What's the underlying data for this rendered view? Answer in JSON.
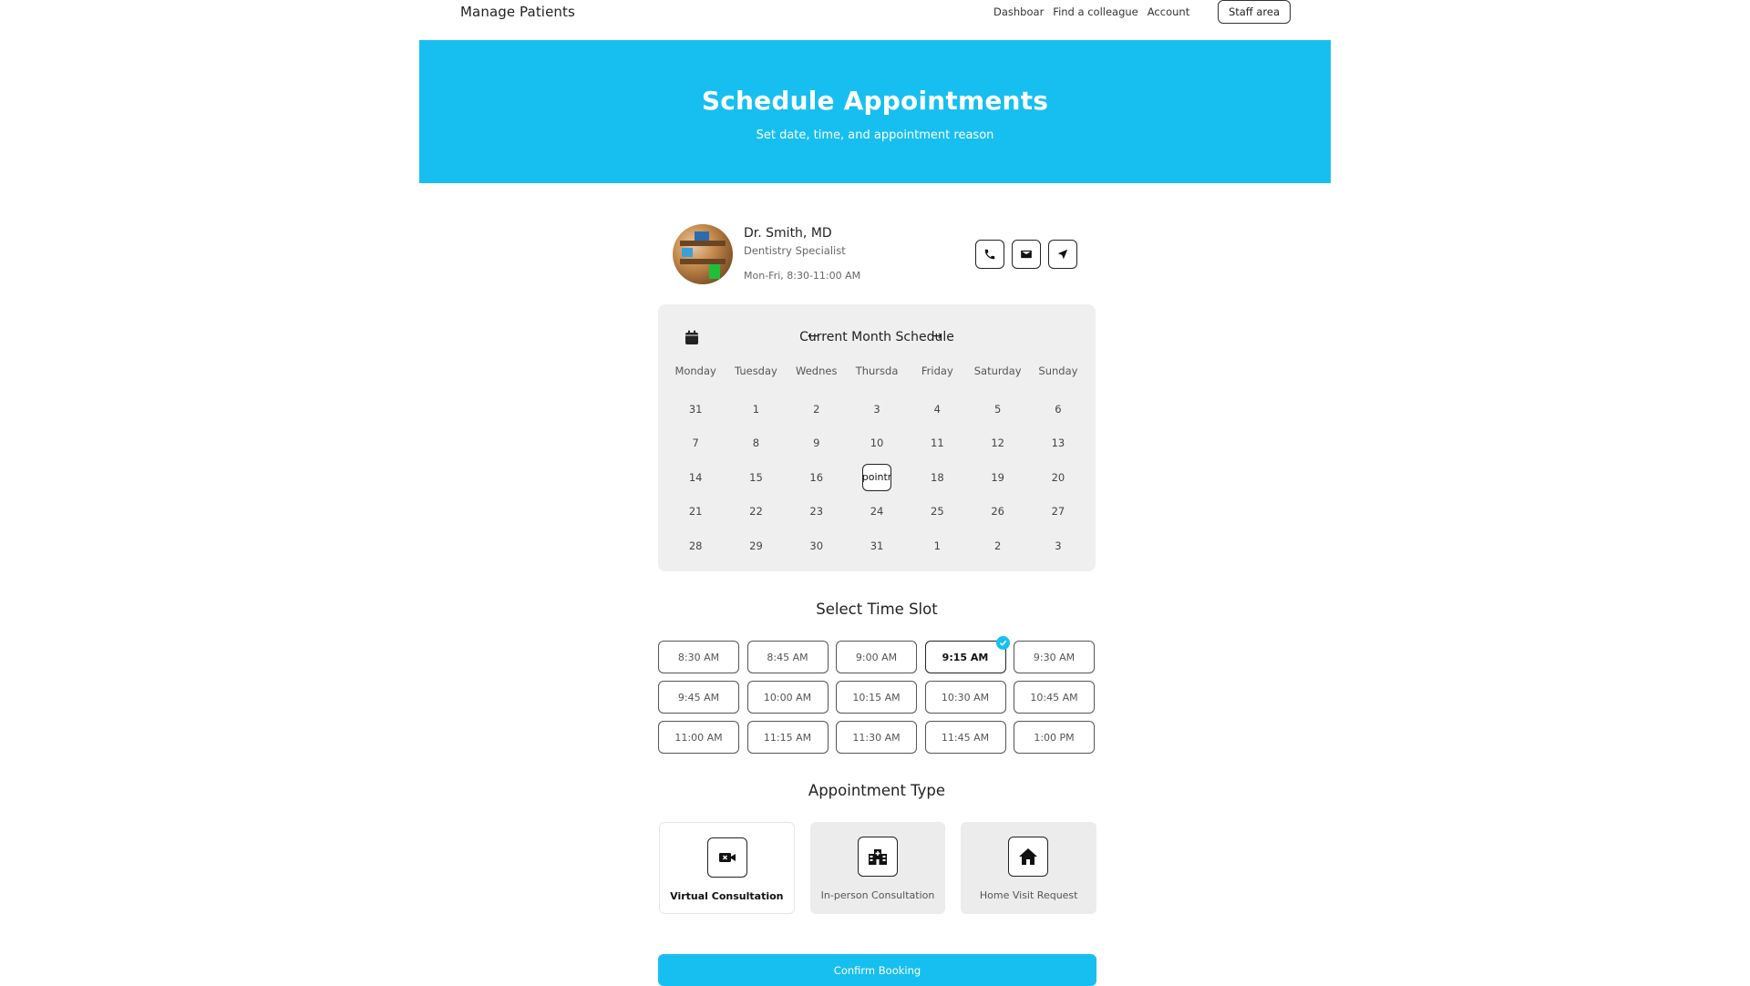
{
  "nav": {
    "brand": "Manage Patients",
    "links": [
      "Dashboar",
      "Find a colleague",
      "Account"
    ],
    "staff_label": "Staff area"
  },
  "hero": {
    "title": "Schedule Appointments",
    "subtitle": "Set date, time, and appointment reason"
  },
  "doctor": {
    "name": "Dr. Smith, MD",
    "specialty": "Dentistry Specialist",
    "hours": "Mon-Fri, 8:30-11:00 AM",
    "actions": [
      "phone-icon",
      "mail-icon",
      "navigation-icon"
    ]
  },
  "calendar": {
    "title": "Current Month Schedule",
    "prev_glyph": "←",
    "next_glyph": "→",
    "weekdays": [
      "Monday",
      "Tuesday",
      "Wednes",
      "Thursda",
      "Friday",
      "Saturday",
      "Sunday"
    ],
    "weeks": [
      [
        "31",
        "1",
        "2",
        "3",
        "4",
        "5",
        "6"
      ],
      [
        "7",
        "8",
        "9",
        "10",
        "11",
        "12",
        "13"
      ],
      [
        "14",
        "15",
        "16",
        "pointr",
        "18",
        "19",
        "20"
      ],
      [
        "21",
        "22",
        "23",
        "24",
        "25",
        "26",
        "27"
      ],
      [
        "28",
        "29",
        "30",
        "31",
        "1",
        "2",
        "3"
      ]
    ],
    "selected_cell": "pointr"
  },
  "time_slot": {
    "title": "Select Time Slot",
    "slots": [
      "8:30 AM",
      "8:45 AM",
      "9:00 AM",
      "9:15 AM",
      "9:30 AM",
      "9:45 AM",
      "10:00 AM",
      "10:15 AM",
      "10:30 AM",
      "10:45 AM",
      "11:00 AM",
      "11:15 AM",
      "11:30 AM",
      "11:45 AM",
      "1:00 PM"
    ],
    "selected": "9:15 AM"
  },
  "appointment_type": {
    "title": "Appointment Type",
    "options": [
      {
        "label": "Virtual Consultation",
        "icon": "video-icon",
        "selected": true
      },
      {
        "label": "In-person Consultation",
        "icon": "hospital-icon",
        "selected": false
      },
      {
        "label": "Home Visit Request",
        "icon": "home-icon",
        "selected": false
      }
    ]
  },
  "confirm_label": "Confirm Booking",
  "colors": {
    "accent": "#17bff0",
    "panel": "#efefef"
  }
}
